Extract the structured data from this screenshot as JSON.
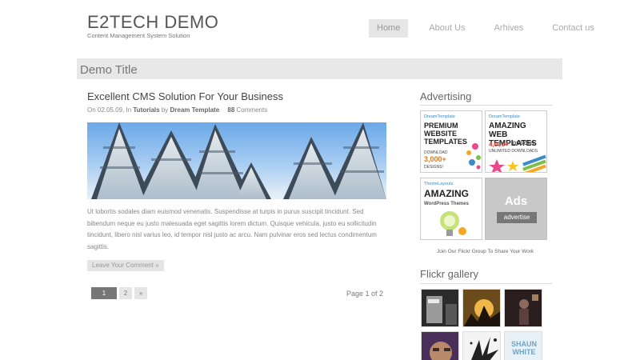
{
  "header": {
    "logo_title": "E2TECH DEMO",
    "logo_subtitle": "Content Management System Solution"
  },
  "nav": {
    "items": [
      {
        "label": "Home",
        "active": true
      },
      {
        "label": "About Us",
        "active": false
      },
      {
        "label": "Arhives",
        "active": false
      },
      {
        "label": "Contact us",
        "active": false
      }
    ]
  },
  "page_title": "Demo Title",
  "post": {
    "title": "Excellent CMS Solution For Your Business",
    "date_prefix": "On 02.05.09, In",
    "category": "Tutorials",
    "by_text": "by",
    "author": "Dream Template",
    "comment_count": "88",
    "comments_label": "Comments",
    "body": "Ut lobortis sodales diam euismod venenatis. Suspendisse at turpis in purus suscipit tincidunt. Sed bibendum neque eu justo malesuada eget sagittis lorem dictum. Quisque vehicula, justo eu sollicitudin tincidunt, libero nisl varius leo, id tempor nisl justo ac arcu. Nam pulvinar eros sed lectus condimentum sagittis.",
    "leave_comment": "Leave Your Comment »"
  },
  "pagination": {
    "current": "1",
    "page2": "2",
    "next": "»",
    "page_of": "Page 1 of 2"
  },
  "sidebar": {
    "advertising_title": "Advertising",
    "ads": [
      {
        "brand": "DreamTemplate",
        "headline": "PREMIUM WEBSITE TEMPLATES",
        "sub": "DOWNLOAD",
        "value": "3,000+",
        "tail": "DESIGNS!"
      },
      {
        "brand": "DreamTemplate",
        "headline": "AMAZING WEB TEMPLATES",
        "value": "4,000+",
        "sub": "DESIGNS",
        "tail": "UNLIMITED DOWNLOADS"
      },
      {
        "brand": "ThemeLayouts",
        "headline": "AMAZING",
        "sub": "WordPress Themes"
      },
      {
        "word": "Ads",
        "button": "advertise"
      }
    ],
    "flickr_link": "Join Our Flickr Group To Share Your Work",
    "flickr_title": "Flickr gallery",
    "thumb_text": "SHAUN WHITE"
  },
  "colors": {
    "nav_active_bg": "#e6e6e6",
    "title_bar_bg": "#e8e8e8",
    "pager_current_bg": "#777777",
    "ad_brand_blue": "#3a8bc9",
    "ad_orange": "#e07a1a"
  }
}
